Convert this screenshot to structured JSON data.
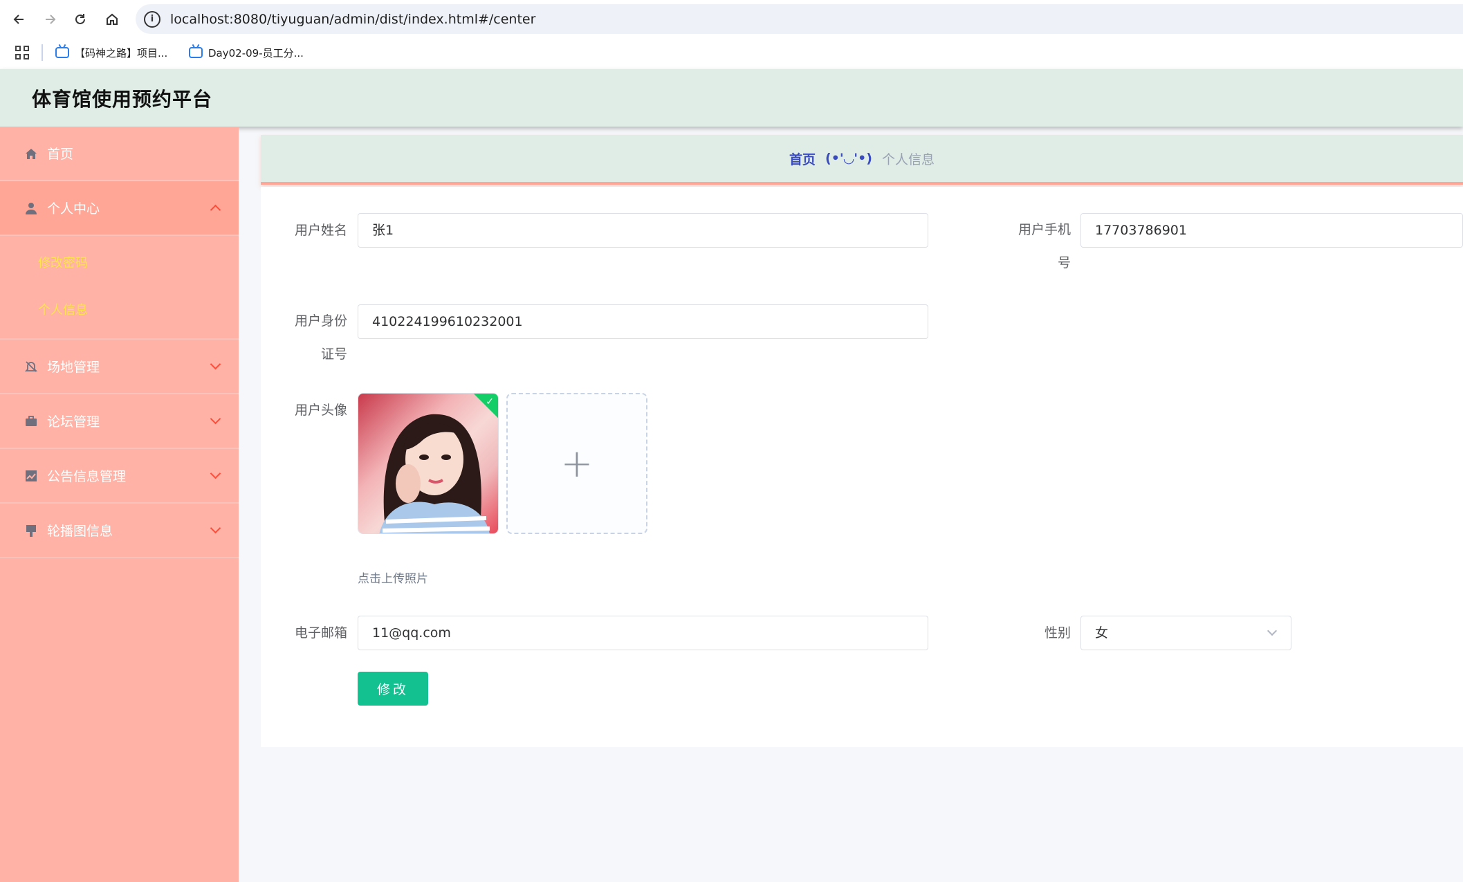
{
  "browser": {
    "url_host": "localhost",
    "url_rest": ":8080/tiyuguan/admin/dist/index.html#/center",
    "bookmarks": [
      {
        "label": "【码神之路】项目..."
      },
      {
        "label": "Day02-09-员工分..."
      }
    ]
  },
  "app": {
    "title": "体育馆使用预约平台"
  },
  "sidebar": {
    "items": [
      {
        "label": "首页",
        "icon": "home-icon"
      },
      {
        "label": "个人中心",
        "icon": "user-icon",
        "expanded": true,
        "children": [
          {
            "label": "修改密码"
          },
          {
            "label": "个人信息"
          }
        ]
      },
      {
        "label": "场地管理",
        "icon": "bell-off-icon"
      },
      {
        "label": "论坛管理",
        "icon": "briefcase-icon"
      },
      {
        "label": "公告信息管理",
        "icon": "chart-icon"
      },
      {
        "label": "轮播图信息",
        "icon": "brush-icon"
      }
    ]
  },
  "breadcrumb": {
    "home": "首页",
    "separator": "(•'◡'•)",
    "current": "个人信息"
  },
  "form": {
    "name_label": "用户姓名",
    "name_value": "张1",
    "phone_label": "用户手机号",
    "phone_value": "17703786901",
    "idcard_label": "用户身份证号",
    "idcard_value": "410224199610232001",
    "avatar_label": "用户头像",
    "upload_plus": "+",
    "upload_tip": "点击上传照片",
    "email_label": "电子邮箱",
    "email_value": "11@qq.com",
    "gender_label": "性别",
    "gender_value": "女",
    "submit_label": "修改"
  },
  "colors": {
    "sidebar_bg": "#ffb2a5",
    "header_bg": "#dfede6",
    "submenu_text": "#ffe44d",
    "accent_button": "#13c08f",
    "breadcrumb_link": "#3a4bbf"
  }
}
